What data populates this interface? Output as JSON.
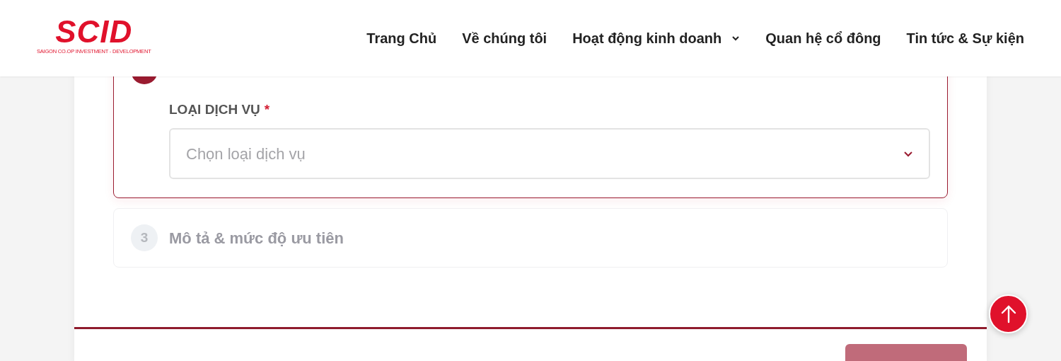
{
  "logo": {
    "mark": "SCID",
    "tagline": "SAIGON CO.OP INVESTMENT - DEVELOPMENT"
  },
  "nav": [
    {
      "label": "Trang Chủ",
      "dropdown": false
    },
    {
      "label": "Về chúng tôi",
      "dropdown": false
    },
    {
      "label": "Hoạt động kinh doanh",
      "dropdown": true
    },
    {
      "label": "Quan hệ cổ đông",
      "dropdown": false
    },
    {
      "label": "Tin tức & Sự kiện",
      "dropdown": false
    }
  ],
  "steps": [
    {
      "active": true,
      "field": {
        "label": "LOẠI DỊCH VỤ",
        "required": true,
        "required_mark": "*",
        "placeholder": "Chọn loại dịch vụ"
      }
    },
    {
      "active": false,
      "number": "3",
      "title": "Mô tả & mức độ ưu tiên"
    }
  ],
  "footer": {
    "next_button": {
      "disabled": true
    }
  }
}
